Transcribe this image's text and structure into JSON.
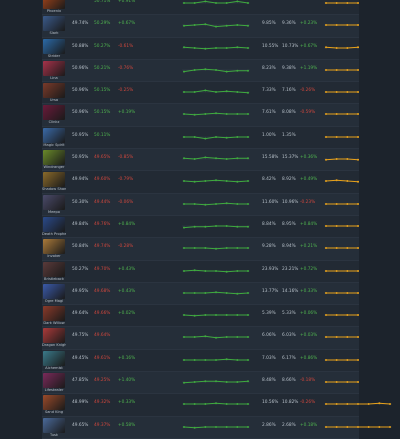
{
  "colors": {
    "positive": "#4fb34f",
    "negative": "#d0473d",
    "spark_green": "#3faa3f",
    "spark_orange": "#e8a21c"
  },
  "rows": [
    {
      "name": "Phoenix",
      "matches": "",
      "wr": "50.71%",
      "wr_class": "pos",
      "delta": "+0.91%",
      "delta_class": "pos",
      "b1": "",
      "b2": "",
      "b3": "",
      "b3_class": "pos",
      "icon": "#a4441a",
      "spark": [
        0.5,
        0.5,
        0.6,
        0.5,
        0.5,
        0.6,
        0.5
      ],
      "spark2": [
        0.5,
        0.5,
        0.5,
        0.5,
        0.5,
        0.5,
        0.5
      ]
    },
    {
      "name": "Slark",
      "matches": "49.74%",
      "wr": "50.29%",
      "wr_class": "pos",
      "delta": "+0.67%",
      "delta_class": "pos",
      "b1": "9.85%",
      "b2": "9.36%",
      "b3": "+0.23%",
      "b3_class": "pos",
      "icon": "#3a5a8a",
      "spark": [
        0.45,
        0.5,
        0.55,
        0.4,
        0.45,
        0.5,
        0.45
      ],
      "spark2": [
        0.5,
        0.5,
        0.5,
        0.5,
        0.5,
        0.5,
        0.5
      ]
    },
    {
      "name": "Strider",
      "matches": "50.88%",
      "wr": "50.27%",
      "wr_class": "pos",
      "delta": "-0.61%",
      "delta_class": "neg",
      "b1": "10.55%",
      "b2": "10.73%",
      "b3": "+0.67%",
      "b3_class": "pos",
      "icon": "#2b6aa8",
      "spark": [
        0.55,
        0.5,
        0.45,
        0.5,
        0.5,
        0.55,
        0.5
      ],
      "spark2": [
        0.55,
        0.5,
        0.5,
        0.55,
        0.5,
        0.5,
        0.5
      ]
    },
    {
      "name": "Lina",
      "matches": "50.96%",
      "wr": "50.21%",
      "wr_class": "pos",
      "delta": "-0.76%",
      "delta_class": "neg",
      "b1": "8.23%",
      "b2": "9.38%",
      "b3": "+1.19%",
      "b3_class": "pos",
      "icon": "#a6324a",
      "spark": [
        0.4,
        0.5,
        0.55,
        0.5,
        0.4,
        0.45,
        0.45
      ],
      "spark2": [
        0.5,
        0.5,
        0.5,
        0.5,
        0.5,
        0.55,
        0.5
      ]
    },
    {
      "name": "Ursa",
      "matches": "50.96%",
      "wr": "50.15%",
      "wr_class": "pos",
      "delta": "-0.25%",
      "delta_class": "neg",
      "b1": "7.33%",
      "b2": "7.16%",
      "b3": "-0.26%",
      "b3_class": "neg",
      "icon": "#7a3a2a",
      "spark": [
        0.5,
        0.5,
        0.6,
        0.5,
        0.55,
        0.5,
        0.45
      ],
      "spark2": [
        0.5,
        0.5,
        0.5,
        0.5,
        0.5,
        0.5,
        0.5
      ]
    },
    {
      "name": "Clinkz",
      "matches": "50.96%",
      "wr": "50.15%",
      "wr_class": "pos",
      "delta": "+0.19%",
      "delta_class": "pos",
      "b1": "7.61%",
      "b2": "8.08%",
      "b3": "-0.59%",
      "b3_class": "neg",
      "icon": "#6a1a3a",
      "spark": [
        0.5,
        0.45,
        0.5,
        0.55,
        0.5,
        0.5,
        0.5
      ],
      "spark2": [
        0.5,
        0.5,
        0.5,
        0.5,
        0.5,
        0.5,
        0.5
      ]
    },
    {
      "name": "Magic Spirit",
      "matches": "50.95%",
      "wr": "50.11%",
      "wr_class": "pos",
      "delta": "",
      "delta_class": "pos",
      "b1": "1.00%",
      "b2": "1.35%",
      "b3": "",
      "b3_class": "pos",
      "icon": "#3a6aa8",
      "spark": [
        0.5,
        0.5,
        0.4,
        0.5,
        0.45,
        0.5,
        0.5
      ],
      "spark2": [
        0.5,
        0.5,
        0.5,
        0.5,
        0.5,
        0.5,
        0.5
      ]
    },
    {
      "name": "Windranger",
      "matches": "50.95%",
      "wr": "49.65%",
      "wr_class": "neg",
      "delta": "-0.85%",
      "delta_class": "neg",
      "b1": "15.58%",
      "b2": "15.37%",
      "b3": "+0.36%",
      "b3_class": "pos",
      "icon": "#6a8a2a",
      "spark": [
        0.55,
        0.5,
        0.6,
        0.55,
        0.5,
        0.55,
        0.55
      ],
      "spark2": [
        0.45,
        0.5,
        0.5,
        0.45,
        0.5,
        0.5,
        0.5
      ]
    },
    {
      "name": "Shadow Shaman",
      "matches": "49.94%",
      "wr": "49.60%",
      "wr_class": "neg",
      "delta": "-0.79%",
      "delta_class": "neg",
      "b1": "8.42%",
      "b2": "8.92%",
      "b3": "+0.49%",
      "b3_class": "pos",
      "icon": "#8a6a2a",
      "spark": [
        0.5,
        0.45,
        0.5,
        0.55,
        0.5,
        0.45,
        0.5
      ],
      "spark2": [
        0.5,
        0.55,
        0.5,
        0.45,
        0.5,
        0.5,
        0.45
      ]
    },
    {
      "name": "Meepo",
      "matches": "50.30%",
      "wr": "49.44%",
      "wr_class": "neg",
      "delta": "-0.06%",
      "delta_class": "neg",
      "b1": "11.60%",
      "b2": "10.96%",
      "b3": "-0.23%",
      "b3_class": "neg",
      "icon": "#4a4a6a",
      "spark": [
        0.5,
        0.5,
        0.45,
        0.5,
        0.55,
        0.5,
        0.5
      ],
      "spark2": [
        0.5,
        0.5,
        0.5,
        0.5,
        0.5,
        0.5,
        0.5
      ]
    },
    {
      "name": "Death Prophet",
      "matches": "49.84%",
      "wr": "49.76%",
      "wr_class": "neg",
      "delta": "+0.84%",
      "delta_class": "pos",
      "b1": "8.84%",
      "b2": "8.95%",
      "b3": "+0.84%",
      "b3_class": "pos",
      "icon": "#2a4a8a",
      "spark": [
        0.4,
        0.45,
        0.45,
        0.5,
        0.5,
        0.45,
        0.45
      ],
      "spark2": [
        0.5,
        0.5,
        0.5,
        0.5,
        0.5,
        0.5,
        0.5
      ]
    },
    {
      "name": "Invoker",
      "matches": "50.84%",
      "wr": "49.74%",
      "wr_class": "neg",
      "delta": "-0.28%",
      "delta_class": "neg",
      "b1": "9.28%",
      "b2": "8.94%",
      "b3": "+0.21%",
      "b3_class": "pos",
      "icon": "#aa7a3a",
      "spark": [
        0.5,
        0.5,
        0.5,
        0.45,
        0.5,
        0.5,
        0.5
      ],
      "spark2": [
        0.5,
        0.5,
        0.5,
        0.5,
        0.5,
        0.5,
        0.5
      ]
    },
    {
      "name": "Bristleback",
      "matches": "50.27%",
      "wr": "49.70%",
      "wr_class": "neg",
      "delta": "+0.43%",
      "delta_class": "pos",
      "b1": "23.93%",
      "b2": "23.21%",
      "b3": "+0.72%",
      "b3_class": "pos",
      "icon": "#5a3a3a",
      "spark": [
        0.5,
        0.55,
        0.5,
        0.5,
        0.45,
        0.5,
        0.5
      ],
      "spark2": [
        0.5,
        0.5,
        0.5,
        0.5,
        0.5,
        0.5,
        0.5
      ]
    },
    {
      "name": "Ogre Magi",
      "matches": "49.95%",
      "wr": "49.68%",
      "wr_class": "neg",
      "delta": "+0.43%",
      "delta_class": "pos",
      "b1": "13.77%",
      "b2": "14.16%",
      "b3": "+0.33%",
      "b3_class": "pos",
      "icon": "#3a5aaa",
      "spark": [
        0.5,
        0.5,
        0.5,
        0.55,
        0.5,
        0.45,
        0.5
      ],
      "spark2": [
        0.5,
        0.5,
        0.5,
        0.5,
        0.5,
        0.5,
        0.5
      ]
    },
    {
      "name": "Dark Willow",
      "matches": "49.64%",
      "wr": "49.66%",
      "wr_class": "neg",
      "delta": "+0.02%",
      "delta_class": "pos",
      "b1": "5.39%",
      "b2": "5.33%",
      "b3": "+0.06%",
      "b3_class": "pos",
      "icon": "#8a3a2a",
      "spark": [
        0.5,
        0.45,
        0.5,
        0.5,
        0.5,
        0.5,
        0.5
      ],
      "spark2": [
        0.5,
        0.5,
        0.5,
        0.5,
        0.5,
        0.5,
        0.5
      ]
    },
    {
      "name": "Dragon Knight",
      "matches": "49.75%",
      "wr": "49.64%",
      "wr_class": "neg",
      "delta": "",
      "delta_class": "pos",
      "b1": "6.06%",
      "b2": "6.03%",
      "b3": "+0.03%",
      "b3_class": "pos",
      "icon": "#aa3a3a",
      "spark": [
        0.5,
        0.5,
        0.55,
        0.45,
        0.5,
        0.5,
        0.5
      ],
      "spark2": [
        0.5,
        0.5,
        0.5,
        0.5,
        0.5,
        0.5,
        0.5
      ]
    },
    {
      "name": "Alchemist",
      "matches": "49.45%",
      "wr": "49.61%",
      "wr_class": "neg",
      "delta": "+0.16%",
      "delta_class": "pos",
      "b1": "7.03%",
      "b2": "6.17%",
      "b3": "+0.86%",
      "b3_class": "pos",
      "icon": "#3a7a8a",
      "spark": [
        0.5,
        0.5,
        0.5,
        0.5,
        0.55,
        0.5,
        0.5
      ],
      "spark2": [
        0.5,
        0.5,
        0.5,
        0.5,
        0.5,
        0.5,
        0.5
      ]
    },
    {
      "name": "Lifestealer",
      "matches": "47.85%",
      "wr": "49.25%",
      "wr_class": "neg",
      "delta": "+1.40%",
      "delta_class": "pos",
      "b1": "8.48%",
      "b2": "8.66%",
      "b3": "-0.18%",
      "b3_class": "neg",
      "icon": "#7a2a5a",
      "spark": [
        0.45,
        0.5,
        0.55,
        0.55,
        0.5,
        0.5,
        0.55
      ],
      "spark2": [
        0.5,
        0.5,
        0.5,
        0.5,
        0.5,
        0.5,
        0.5
      ]
    },
    {
      "name": "Sand King",
      "matches": "48.99%",
      "wr": "49.32%",
      "wr_class": "neg",
      "delta": "+0.33%",
      "delta_class": "pos",
      "b1": "10.56%",
      "b2": "10.82%",
      "b3": "-0.26%",
      "b3_class": "neg",
      "icon": "#9a4a2a",
      "spark": [
        0.5,
        0.5,
        0.5,
        0.55,
        0.5,
        0.5,
        0.5
      ],
      "spark2": [
        0.5,
        0.5,
        0.5,
        0.5,
        0.5,
        0.55,
        0.5
      ]
    },
    {
      "name": "Tusk",
      "matches": "49.65%",
      "wr": "49.37%",
      "wr_class": "neg",
      "delta": "+0.58%",
      "delta_class": "pos",
      "b1": "2.86%",
      "b2": "2.68%",
      "b3": "+0.18%",
      "b3_class": "pos",
      "icon": "#4a6a9a",
      "spark": [
        0.5,
        0.45,
        0.5,
        0.5,
        0.5,
        0.5,
        0.5
      ],
      "spark2": [
        0.5,
        0.5,
        0.5,
        0.5,
        0.5,
        0.5,
        0.5
      ]
    }
  ]
}
